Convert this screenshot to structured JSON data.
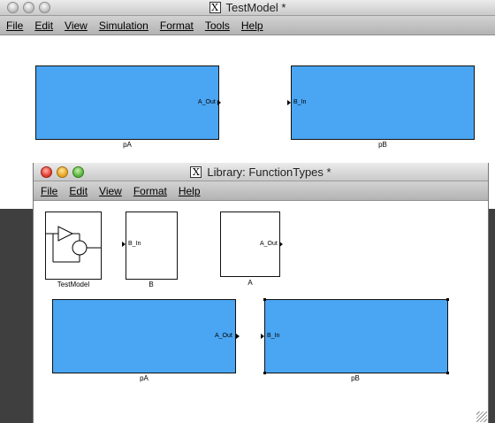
{
  "main_window": {
    "title": "TestModel *",
    "menu": [
      "File",
      "Edit",
      "View",
      "Simulation",
      "Format",
      "Tools",
      "Help"
    ],
    "blocks": [
      {
        "name": "pA",
        "port_label": "A_Out"
      },
      {
        "name": "pB",
        "port_label": "B_In"
      }
    ]
  },
  "library_window": {
    "title": "Library: FunctionTypes *",
    "menu": [
      "File",
      "Edit",
      "View",
      "Format",
      "Help"
    ],
    "small_blocks": [
      {
        "name": "TestModel"
      },
      {
        "name": "B",
        "port_label": "B_In"
      },
      {
        "name": "A",
        "port_label": "A_Out"
      }
    ],
    "blocks": [
      {
        "name": "pA",
        "port_label": "A_Out"
      },
      {
        "name": "pB",
        "port_label": "B_In"
      }
    ]
  },
  "colors": {
    "block_fill": "#4aa5f2",
    "canvas": "#ffffff",
    "desktop": "#3f3f3f"
  },
  "icons": [
    "window-close-light",
    "window-minimize-light",
    "window-zoom-light",
    "x11-app-icon",
    "subsystem-icon",
    "resize-grip-icon"
  ]
}
